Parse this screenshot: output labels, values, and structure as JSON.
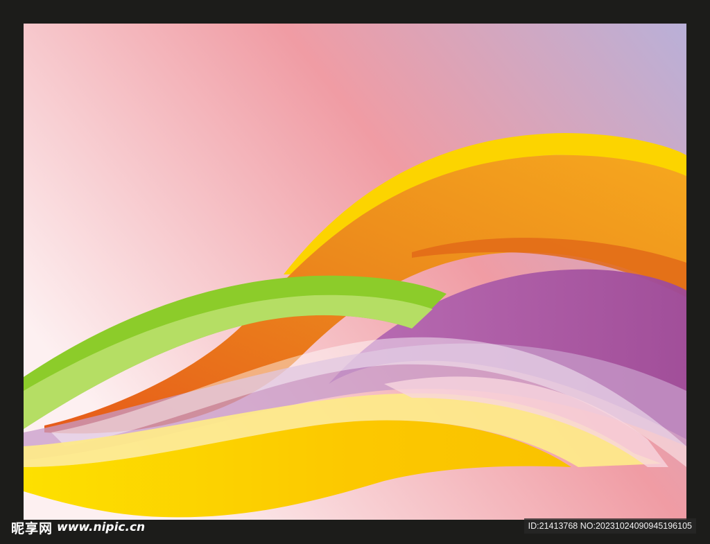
{
  "artwork": {
    "description_free": true,
    "colors": {
      "frame": "#1c1c1a",
      "background_left": "#fbe4e6",
      "background_mid": "#f09ca4",
      "background_right": "#bbaed6",
      "orange": "#e8701a",
      "orange_light": "#f6a21b",
      "yellow": "#fcd000",
      "yellow_light": "#fde98a",
      "green": "#7dc524",
      "green_light": "#b8e06a",
      "purple": "#a254a0",
      "purple_light": "#c89ccb"
    }
  },
  "watermark": {
    "brand": "昵享网",
    "site": "www.nipic.cn",
    "id_text": "ID:21413768 NO:20231024090945196105"
  }
}
